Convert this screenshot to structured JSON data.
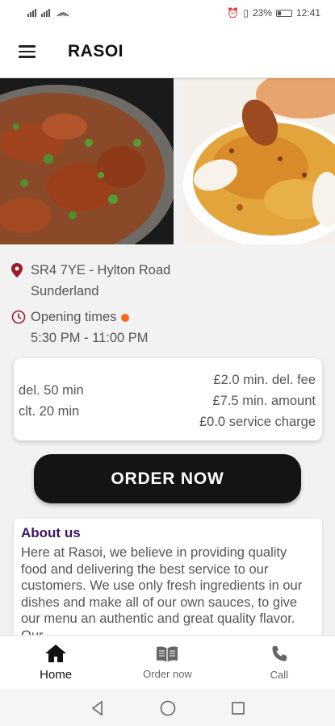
{
  "status_bar": {
    "signal_text": "ill ill",
    "battery_percent": "23%",
    "time": "12:41"
  },
  "app_bar": {
    "title": "RASOI",
    "menu_icon": "hamburger-menu-icon"
  },
  "hero": {
    "images": [
      "curry-dish-image",
      "biryani-dish-image"
    ]
  },
  "info": {
    "address_line1": "SR4 7YE - Hylton Road",
    "address_line2": "Sunderland",
    "opening_label": "Opening times",
    "opening_hours": "5:30 PM - 11:00 PM",
    "status_color": "#f26a1b"
  },
  "fees": {
    "delivery_time": "del. 50 min",
    "collection_time": "clt. 20 min",
    "min_delivery_fee": "£2.0 min. del. fee",
    "min_amount": "£7.5 min. amount",
    "service_charge": "£0.0 service charge"
  },
  "order_button": {
    "label": "ORDER NOW"
  },
  "about": {
    "title": "About us",
    "text": "Here at Rasoi, we believe in providing quality food and delivering the best service to our customers. We use only fresh ingredients in our dishes and make all of our own sauces, to give our menu an authentic and great quality flavor. Our"
  },
  "bottom_nav": {
    "items": [
      {
        "label": "Home",
        "icon": "home-icon",
        "active": true
      },
      {
        "label": "Order now",
        "icon": "menu-book-icon",
        "active": false
      },
      {
        "label": "Call",
        "icon": "phone-icon",
        "active": false
      }
    ]
  },
  "colors": {
    "accent": "#141414",
    "about_title": "#3d1463",
    "location_pin": "#9b1b2b",
    "open_dot": "#f26a1b"
  }
}
